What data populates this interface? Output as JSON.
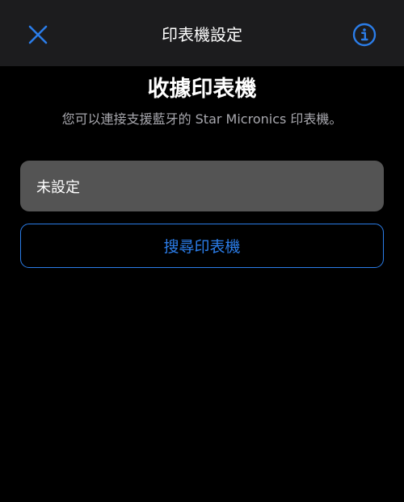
{
  "nav": {
    "title": "印表機設定",
    "close_icon": "close-icon",
    "info_icon": "info-icon"
  },
  "main": {
    "heading": "收據印表機",
    "subtitle": "您可以連接支援藍牙的 Star Micronics 印表機。",
    "printer_status": "未設定",
    "search_button_label": "搜尋印表機"
  },
  "colors": {
    "accent": "#2b7de9",
    "background": "#000000",
    "nav_background": "#1c1c1e",
    "field_background": "#545454"
  }
}
